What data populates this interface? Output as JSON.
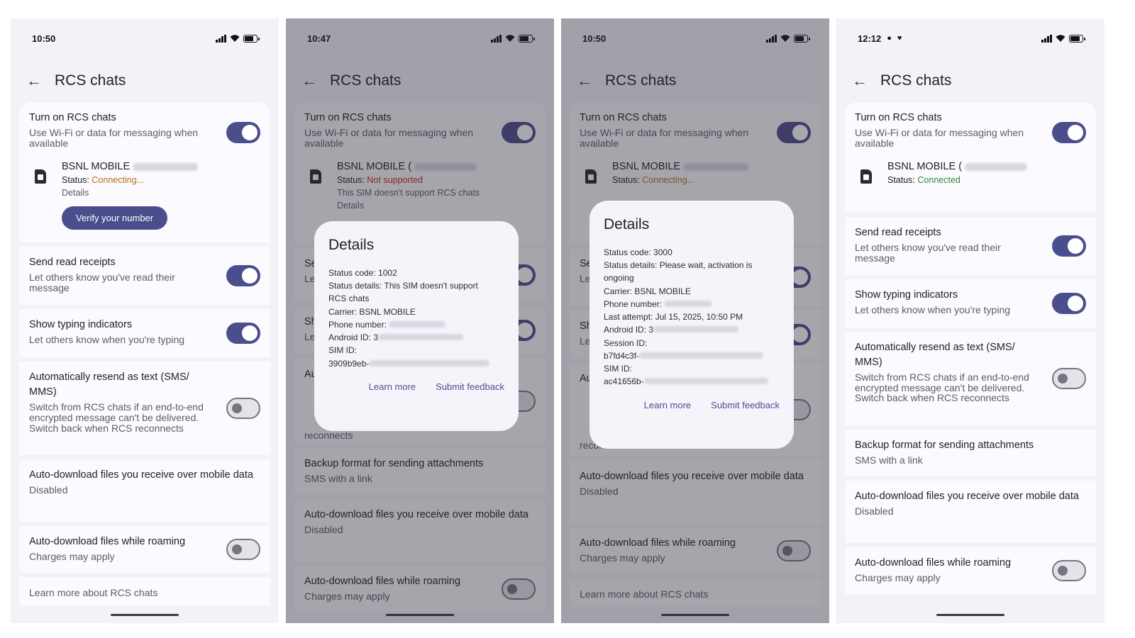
{
  "colors": {
    "accent": "#4b4e8c",
    "connecting": "#b3731a",
    "not_supported": "#c42b1c",
    "connected": "#2e8a3a"
  },
  "icons": {
    "back": "arrow-back-icon",
    "sim": "sim-card-icon"
  },
  "screens": [
    {
      "time": "10:50",
      "title": "RCS chats",
      "rcs": {
        "title": "Turn on RCS chats",
        "sub": "Use Wi-Fi or data for messaging when available",
        "on": true
      },
      "sim": {
        "name": "BSNL MOBILE",
        "status_label": "Status:",
        "status": "Connecting...",
        "details": "Details",
        "verify": "Verify your number"
      },
      "read": {
        "title": "Send read receipts",
        "sub": "Let others know you've read their message",
        "on": true
      },
      "typing": {
        "title": "Show typing indicators",
        "sub": "Let others know when you're typing",
        "on": true
      },
      "resend": {
        "title": "Automatically resend as text (SMS/ MMS)",
        "sub": "Switch from RCS chats if an end-to-end encrypted message can't be delivered. Switch back when RCS reconnects",
        "on": false
      },
      "autodl": {
        "title": "Auto-download files you receive over mobile data",
        "sub": "Disabled"
      },
      "roaming": {
        "title": "Auto-download files while roaming",
        "sub": "Charges may apply",
        "on": false
      },
      "learn": "Learn more about RCS chats"
    },
    {
      "time": "10:47",
      "title": "RCS chats",
      "rcs": {
        "title": "Turn on RCS chats",
        "sub": "Use Wi-Fi or data for messaging when available",
        "on": true
      },
      "sim": {
        "name": "BSNL MOBILE (",
        "status_label": "Status:",
        "status": "Not supported",
        "note": "This SIM doesn't support RCS chats",
        "details": "Details"
      },
      "read": {
        "title": "Se",
        "sub": "Le"
      },
      "typing": {
        "title": "Sh",
        "sub": "Le"
      },
      "resend": {
        "title": "Au",
        "sub": "reconnects"
      },
      "backup": {
        "title": "Backup format for sending attachments",
        "sub": "SMS with a link"
      },
      "autodl": {
        "title": "Auto-download files you receive over mobile data",
        "sub": "Disabled"
      },
      "roaming": {
        "title": "Auto-download files while roaming",
        "sub": "Charges may apply",
        "on": false
      },
      "dialog": {
        "title": "Details",
        "lines": [
          "Status code: 1002",
          "Status details: This SIM doesn't support",
          "RCS chats",
          "Carrier: BSNL MOBILE",
          "Phone number:",
          "Android ID: 3",
          "SIM ID:",
          "3909b9eb-"
        ],
        "learn": "Learn more",
        "feedback": "Submit feedback"
      }
    },
    {
      "time": "10:50",
      "title": "RCS chats",
      "rcs": {
        "title": "Turn on RCS chats",
        "sub": "Use Wi-Fi or data for messaging when available",
        "on": true
      },
      "sim": {
        "name": "BSNL MOBILE",
        "status_label": "Status:",
        "status": "Connecting..."
      },
      "read": {
        "title": "Se",
        "sub": "Le"
      },
      "typing": {
        "title": "Sh",
        "sub": "Le"
      },
      "resend": {
        "title": "Au",
        "sub": "reconnects"
      },
      "autodl": {
        "title": "Auto-download files you receive over mobile data",
        "sub": "Disabled"
      },
      "roaming": {
        "title": "Auto-download files while roaming",
        "sub": "Charges may apply",
        "on": false
      },
      "learn": "Learn more about RCS chats",
      "dialog": {
        "title": "Details",
        "lines": [
          "Status code: 3000",
          "Status details: Please wait, activation is",
          "ongoing",
          "Carrier: BSNL MOBILE",
          "Phone number:",
          "Last attempt: Jul 15, 2025, 10:50 PM",
          "Android ID: 3",
          "Session ID:",
          "b7fd4c3f-",
          "SIM ID:",
          "ac41656b-"
        ],
        "learn": "Learn more",
        "feedback": "Submit feedback"
      }
    },
    {
      "time": "12:12",
      "title": "RCS chats",
      "rcs": {
        "title": "Turn on RCS chats",
        "sub": "Use Wi-Fi or data for messaging when available",
        "on": true
      },
      "sim": {
        "name": "BSNL MOBILE (",
        "status_label": "Status:",
        "status": "Connected"
      },
      "read": {
        "title": "Send read receipts",
        "sub": "Let others know you've read their message",
        "on": true
      },
      "typing": {
        "title": "Show typing indicators",
        "sub": "Let others know when you're typing",
        "on": true
      },
      "resend": {
        "title": "Automatically resend as text (SMS/ MMS)",
        "sub": "Switch from RCS chats if an end-to-end encrypted message can't be delivered. Switch back when RCS reconnects",
        "on": false
      },
      "backup": {
        "title": "Backup format for sending attachments",
        "sub": "SMS with a link"
      },
      "autodl": {
        "title": "Auto-download files you receive over mobile data",
        "sub": "Disabled"
      },
      "roaming": {
        "title": "Auto-download files while roaming",
        "sub": "Charges may apply",
        "on": false
      }
    }
  ]
}
